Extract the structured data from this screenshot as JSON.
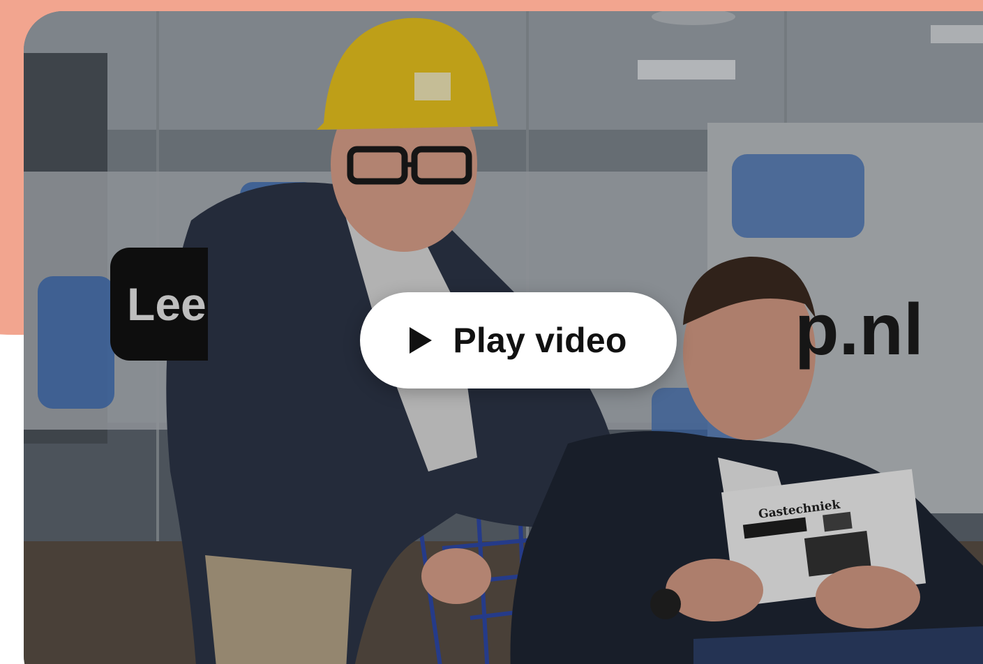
{
  "video": {
    "play_label": "Play video",
    "play_icon": "play-icon"
  },
  "scene": {
    "wall_sign_left": "Lee",
    "wall_sign_right": "p.nl",
    "magazine_title": "Gastechniek"
  },
  "colors": {
    "accent_salmon": "#f2a58f",
    "button_bg": "#ffffff",
    "button_text": "#111111",
    "helmet_yellow": "#e8c21e",
    "sign_blue": "#3f6fb5"
  }
}
